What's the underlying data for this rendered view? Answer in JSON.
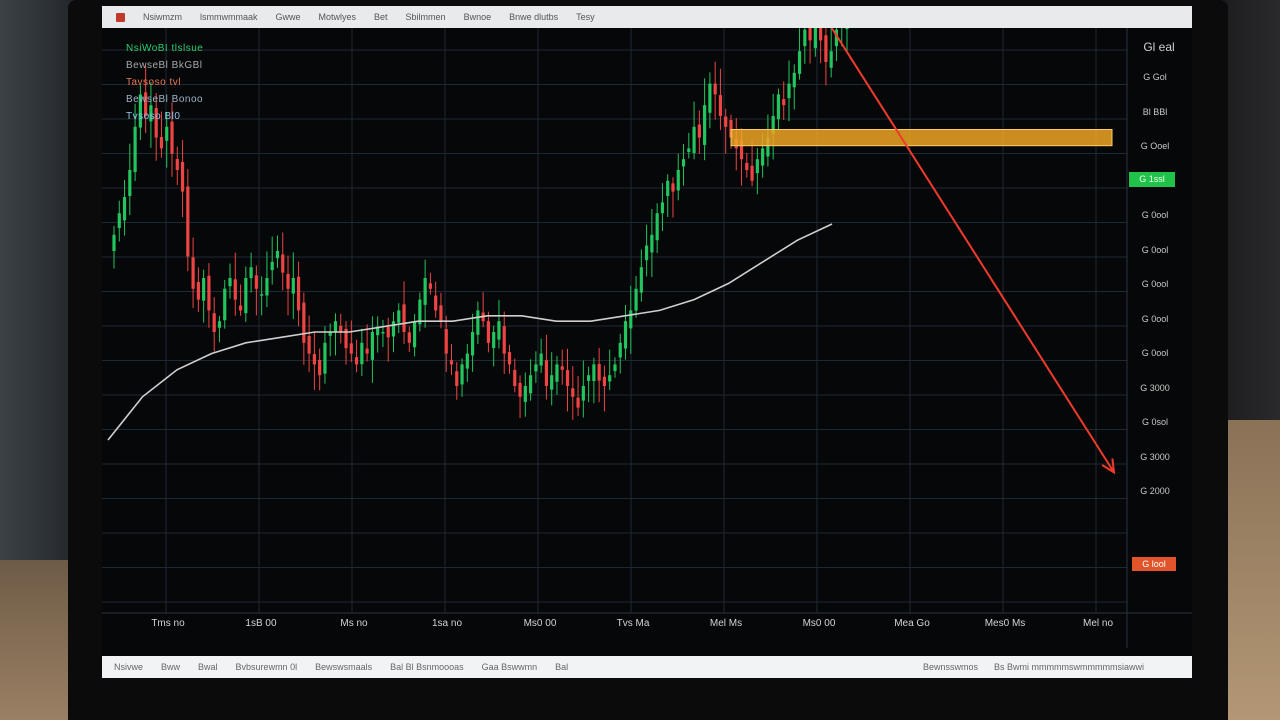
{
  "menu": {
    "items": [
      "Nsiwmzm",
      "lsmmwmmaak",
      "Gwwe",
      "Motwlyes",
      "Bet",
      "Sbilmmen",
      "Bwnoe",
      "Bnwe dlutbs",
      "Tesy"
    ]
  },
  "legend": {
    "lines": [
      "NsiWoBI tlslsue",
      "BewseBl BkGBl",
      "Tavsoso tvl",
      "BewseBl Bonoo",
      "Tvsoso Bl0"
    ]
  },
  "price_axis": {
    "label": "Gl eal",
    "ticks": [
      "G Gol",
      "Bl BBl",
      "G Ooel",
      "G 0ool",
      "G 0ool",
      "G 0ool",
      "G 0ool",
      "G 0ool",
      "G 0ool",
      "G 3000",
      "G 0sol",
      "G 3000",
      "G 2000"
    ],
    "current_green": "G 1ssl",
    "target_red": "G lool"
  },
  "time_axis": {
    "labels": [
      "Tms no",
      "1sB 00",
      "Ms no",
      "1sa no",
      "Ms0 00",
      "Tvs Ma",
      "Mel Ms",
      "Ms0 00",
      "Mea Go",
      "Mes0 Ms",
      "Mel no"
    ]
  },
  "status": {
    "left": [
      "Nsivwe",
      "Bww",
      "Bwal",
      "Bvbsurewmn 0l",
      "Bewswsmaals",
      "Bal  Bl  Bsnmoooas",
      "Gaa Bswwmn",
      "Bal"
    ],
    "right": [
      "Bewnsswmos",
      "Bs  Bwmi mmmmmswmmmmmsiawwi"
    ]
  },
  "chart_data": {
    "type": "candlestick",
    "title": "",
    "colors": {
      "up": "#22c55e",
      "down": "#ef4444",
      "ma": "#cfcfcf",
      "zone": "#f0a524",
      "arrow": "#f03b2c",
      "grid": "#1e2a33"
    },
    "grid": true,
    "candles_per_day": 1,
    "price_range": [
      0,
      100
    ],
    "close": [
      58,
      62,
      65,
      70,
      78,
      84,
      80,
      82,
      76,
      74,
      78,
      73,
      70,
      66,
      54,
      48,
      46,
      50,
      44,
      40,
      42,
      48,
      50,
      46,
      44,
      50,
      52,
      48,
      47,
      50,
      53,
      55,
      51,
      48,
      50,
      44,
      38,
      36,
      34,
      32,
      38,
      40,
      42,
      40,
      37,
      36,
      34,
      38,
      36,
      40,
      41,
      40,
      39,
      42,
      44,
      40,
      38,
      42,
      46,
      50,
      48,
      44,
      42,
      36,
      34,
      30,
      34,
      36,
      40,
      44,
      42,
      38,
      40,
      42,
      36,
      34,
      30,
      28,
      30,
      32,
      34,
      36,
      30,
      32,
      34,
      33,
      30,
      28,
      26,
      30,
      32,
      34,
      31,
      30,
      32,
      34,
      38,
      42,
      44,
      48,
      52,
      56,
      58,
      62,
      64,
      68,
      66,
      70,
      72,
      74,
      78,
      76,
      82,
      86,
      84,
      80,
      78,
      76,
      74,
      72,
      70,
      68,
      72,
      74,
      76,
      80,
      84,
      82,
      86,
      88,
      92,
      96,
      94,
      98,
      94,
      90,
      92,
      96,
      97,
      98
    ],
    "moving_average": [
      20,
      28,
      33,
      36,
      38,
      39,
      40,
      40,
      41,
      42,
      42,
      43,
      43,
      42,
      42,
      43,
      44,
      46,
      49,
      53,
      57,
      60
    ],
    "resistance_zone": {
      "low": 74.5,
      "high": 77.5,
      "from_candle": 117,
      "to_end": true
    },
    "projection_arrow": {
      "from_candle": 135,
      "from_price": 98,
      "to_price": 14
    }
  }
}
